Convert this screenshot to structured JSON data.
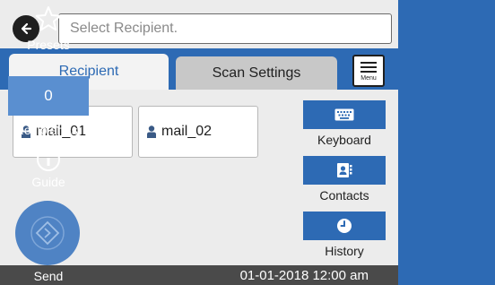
{
  "search": {
    "placeholder": "Select Recipient."
  },
  "tabs": [
    {
      "label": "Recipient",
      "active": true
    },
    {
      "label": "Scan Settings",
      "active": false
    }
  ],
  "menu": {
    "label": "Menu"
  },
  "recipients": [
    {
      "name": "mail_01"
    },
    {
      "name": "mail_02"
    }
  ],
  "side_buttons": {
    "keyboard": "Keyboard",
    "contacts": "Contacts",
    "history": "History"
  },
  "status": {
    "datetime": "01-01-2018 12:00 am"
  },
  "right_panel": {
    "presets": "Presets",
    "recipient_count": "0",
    "recipients_label": "Recipient(s)",
    "guide": "Guide",
    "send": "Send"
  },
  "colors": {
    "accent": "#2d6ab4",
    "panel_light": "#5a8fd0",
    "status_bar": "#4a4a4a"
  },
  "icons": [
    "back-arrow-icon",
    "menu-icon",
    "person-icon",
    "keyboard-icon",
    "contacts-icon",
    "history-icon",
    "star-icon",
    "info-icon",
    "send-diamond-icon"
  ]
}
